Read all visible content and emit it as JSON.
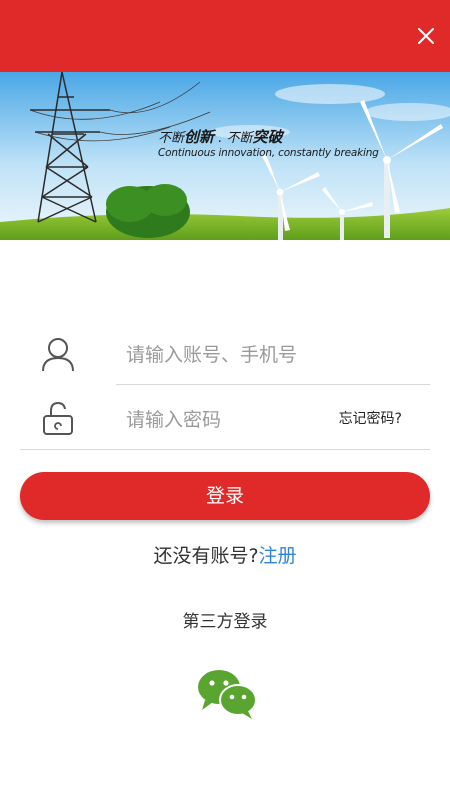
{
  "header": {
    "close_icon": "close-icon",
    "color": "#e02a2a"
  },
  "banner": {
    "slogan_prefix_1": "不断",
    "slogan_bold_1": "创新",
    "slogan_sep": ".",
    "slogan_prefix_2": "不断",
    "slogan_bold_2": "突破",
    "slogan_en": "Continuous innovation, constantly breaking"
  },
  "form": {
    "account_placeholder": "请输入账号、手机号",
    "password_placeholder": "请输入密码",
    "forgot_label": "忘记密码?",
    "account_icon": "user-icon",
    "password_icon": "lock-icon"
  },
  "login": {
    "button_label": "登录",
    "color": "#e02a2a"
  },
  "register": {
    "prompt": "还没有账号?",
    "link": "注册",
    "link_color": "#2f86d6"
  },
  "third_party": {
    "label": "第三方登录",
    "wechat_icon": "wechat-icon",
    "wechat_color": "#5aa52f"
  }
}
